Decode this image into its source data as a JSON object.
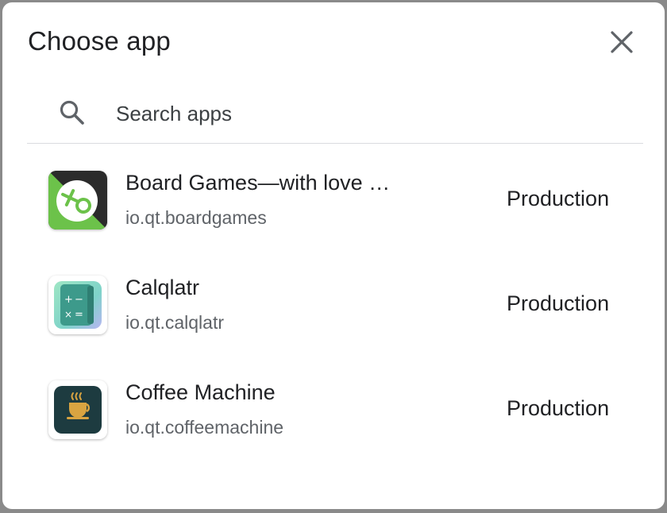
{
  "dialog": {
    "title": "Choose app",
    "close_icon": "close-icon"
  },
  "search": {
    "icon": "search-icon",
    "placeholder": "Search apps",
    "value": ""
  },
  "apps": [
    {
      "name": "Board Games—with love …",
      "package": "io.qt.boardgames",
      "track": "Production",
      "icon": "board-games-app-icon"
    },
    {
      "name": "Calqlatr",
      "package": "io.qt.calqlatr",
      "track": "Production",
      "icon": "calculator-app-icon"
    },
    {
      "name": "Coffee Machine",
      "package": "io.qt.coffeemachine",
      "track": "Production",
      "icon": "coffee-cup-app-icon"
    }
  ],
  "colors": {
    "title_text": "#202124",
    "secondary_text": "#5f6368",
    "divider": "#dadce0",
    "board_games_green": "#6cc24a",
    "board_games_dark": "#2b2b2b",
    "calqlatr_teal": "#3d9a8b",
    "coffee_dark": "#1d3b40",
    "coffee_gold": "#d9a441"
  }
}
